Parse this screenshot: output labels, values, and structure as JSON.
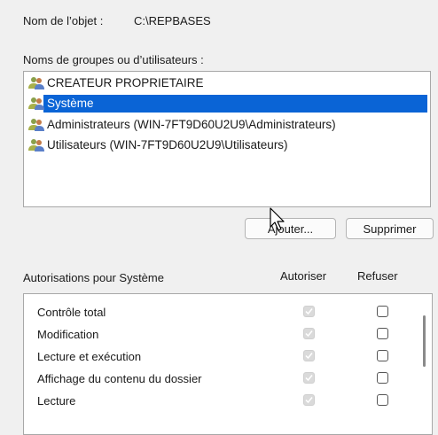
{
  "object": {
    "label": "Nom de l’objet :",
    "value": "C:\\REPBASES"
  },
  "groups": {
    "label": "Noms de groupes ou d’utilisateurs :",
    "items": [
      {
        "name": "CREATEUR PROPRIETAIRE",
        "icon": "users-icon",
        "selected": false
      },
      {
        "name": "Système",
        "icon": "users-icon",
        "selected": true
      },
      {
        "name": "Administrateurs (WIN-7FT9D60U2U9\\Administrateurs)",
        "icon": "users-icon",
        "selected": false
      },
      {
        "name": "Utilisateurs (WIN-7FT9D60U2U9\\Utilisateurs)",
        "icon": "users-icon",
        "selected": false
      }
    ]
  },
  "buttons": {
    "add": "Ajouter...",
    "remove": "Supprimer"
  },
  "permissions": {
    "label": "Autorisations pour Système",
    "allow_header": "Autoriser",
    "deny_header": "Refuser",
    "rows": [
      {
        "name": "Contrôle total",
        "allow": true,
        "deny": false
      },
      {
        "name": "Modification",
        "allow": true,
        "deny": false
      },
      {
        "name": "Lecture et exécution",
        "allow": true,
        "deny": false
      },
      {
        "name": "Affichage du contenu du dossier",
        "allow": true,
        "deny": false
      },
      {
        "name": "Lecture",
        "allow": true,
        "deny": false
      }
    ]
  },
  "colors": {
    "selection": "#0a64d6",
    "background": "#f0f0f0"
  }
}
